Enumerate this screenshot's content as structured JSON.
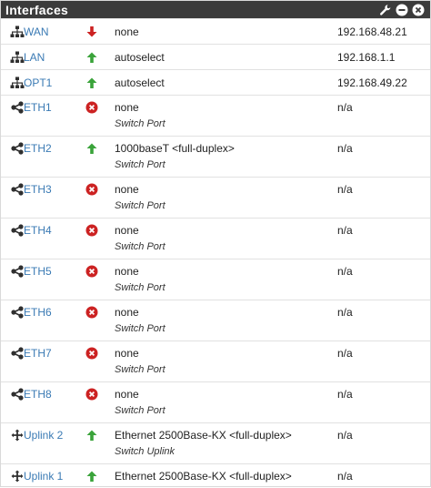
{
  "panel": {
    "title": "Interfaces",
    "icons": [
      "wrench-icon",
      "minus-circle-icon",
      "close-circle-icon"
    ]
  },
  "colors": {
    "header_bg": "#3b3b3b",
    "link": "#3a7ab4",
    "up": "#3aa33a",
    "down": "#cc2222"
  },
  "interfaces": [
    {
      "name": "WAN",
      "type_icon": "network-icon",
      "status": "down",
      "media": "none",
      "sub": "",
      "ip": "192.168.48.21"
    },
    {
      "name": "LAN",
      "type_icon": "network-icon",
      "status": "up",
      "media": "autoselect",
      "sub": "",
      "ip": "192.168.1.1"
    },
    {
      "name": "OPT1",
      "type_icon": "network-icon",
      "status": "up",
      "media": "autoselect",
      "sub": "",
      "ip": "192.168.49.22"
    },
    {
      "name": "ETH1",
      "type_icon": "share-icon",
      "status": "blocked",
      "media": "none",
      "sub": "Switch Port",
      "ip": "n/a"
    },
    {
      "name": "ETH2",
      "type_icon": "share-icon",
      "status": "up",
      "media": "1000baseT <full-duplex>",
      "sub": "Switch Port",
      "ip": "n/a"
    },
    {
      "name": "ETH3",
      "type_icon": "share-icon",
      "status": "blocked",
      "media": "none",
      "sub": "Switch Port",
      "ip": "n/a"
    },
    {
      "name": "ETH4",
      "type_icon": "share-icon",
      "status": "blocked",
      "media": "none",
      "sub": "Switch Port",
      "ip": "n/a"
    },
    {
      "name": "ETH5",
      "type_icon": "share-icon",
      "status": "blocked",
      "media": "none",
      "sub": "Switch Port",
      "ip": "n/a"
    },
    {
      "name": "ETH6",
      "type_icon": "share-icon",
      "status": "blocked",
      "media": "none",
      "sub": "Switch Port",
      "ip": "n/a"
    },
    {
      "name": "ETH7",
      "type_icon": "share-icon",
      "status": "blocked",
      "media": "none",
      "sub": "Switch Port",
      "ip": "n/a"
    },
    {
      "name": "ETH8",
      "type_icon": "share-icon",
      "status": "blocked",
      "media": "none",
      "sub": "Switch Port",
      "ip": "n/a"
    },
    {
      "name": "Uplink 2",
      "type_icon": "arrows-icon",
      "status": "up",
      "media": "Ethernet 2500Base-KX <full-duplex>",
      "sub": "Switch Uplink",
      "ip": "n/a"
    },
    {
      "name": "Uplink 1",
      "type_icon": "arrows-icon",
      "status": "up",
      "media": "Ethernet 2500Base-KX <full-duplex>",
      "sub": "",
      "ip": "n/a"
    }
  ]
}
